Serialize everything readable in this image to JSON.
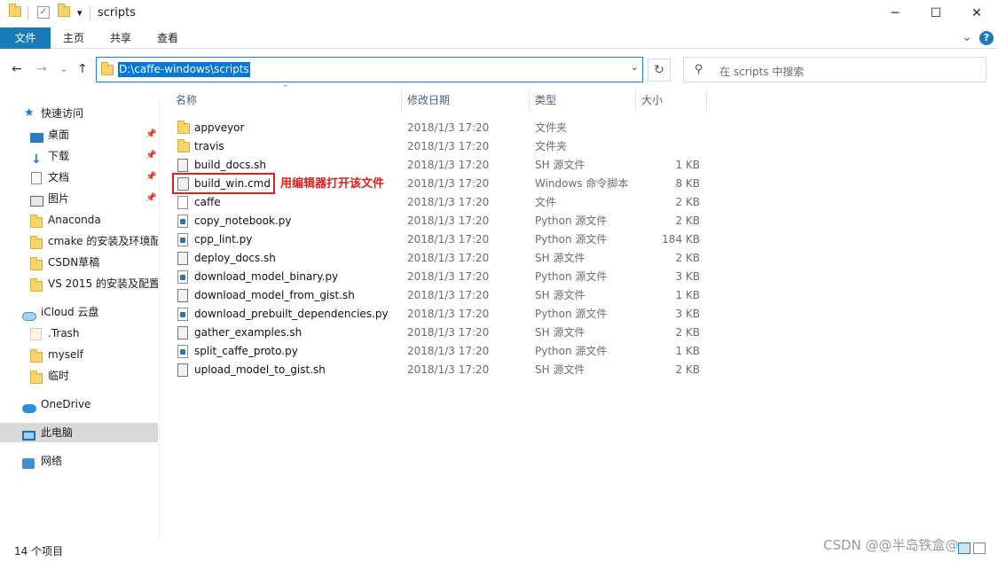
{
  "window": {
    "title": "scripts",
    "minimize": "─",
    "maximize": "☐",
    "close": "✕",
    "quick_access_dropdown": "▾"
  },
  "ribbon": {
    "tabs": [
      "文件",
      "主页",
      "共享",
      "查看"
    ],
    "expand": "⌄",
    "help": "?"
  },
  "address": {
    "path": "D:\\caffe-windows\\scripts",
    "dropdown": "⌄",
    "refresh": "↻",
    "back": "←",
    "forward": "→",
    "recent": "⌄",
    "up": "↑"
  },
  "search": {
    "placeholder": "在 scripts 中搜索"
  },
  "sidebar": {
    "quick_access": "快速访问",
    "items": [
      {
        "label": "桌面",
        "pinned": true
      },
      {
        "label": "下载",
        "pinned": true
      },
      {
        "label": "文档",
        "pinned": true
      },
      {
        "label": "图片",
        "pinned": true
      },
      {
        "label": "Anaconda"
      },
      {
        "label": "cmake 的安装及环境配"
      },
      {
        "label": "CSDN草稿"
      },
      {
        "label": "VS 2015 的安装及配置"
      }
    ],
    "icloud": "iCloud 云盘",
    "icloud_items": [
      ".Trash",
      "myself",
      "临时"
    ],
    "onedrive": "OneDrive",
    "this_pc": "此电脑",
    "network": "网络"
  },
  "columns": {
    "name": "名称",
    "date": "修改日期",
    "type": "类型",
    "size": "大小"
  },
  "files": [
    {
      "name": "appveyor",
      "date": "2018/1/3 17:20",
      "type": "文件夹",
      "size": "",
      "icon": "folder-icon"
    },
    {
      "name": "travis",
      "date": "2018/1/3 17:20",
      "type": "文件夹",
      "size": "",
      "icon": "folder-icon"
    },
    {
      "name": "build_docs.sh",
      "date": "2018/1/3 17:20",
      "type": "SH 源文件",
      "size": "1 KB",
      "icon": "shell-script-icon"
    },
    {
      "name": "build_win.cmd",
      "date": "2018/1/3 17:20",
      "type": "Windows 命令脚本",
      "size": "8 KB",
      "icon": "cmd-script-icon"
    },
    {
      "name": "caffe",
      "date": "2018/1/3 17:20",
      "type": "文件",
      "size": "2 KB",
      "icon": "file-icon"
    },
    {
      "name": "copy_notebook.py",
      "date": "2018/1/3 17:20",
      "type": "Python 源文件",
      "size": "2 KB",
      "icon": "python-file-icon"
    },
    {
      "name": "cpp_lint.py",
      "date": "2018/1/3 17:20",
      "type": "Python 源文件",
      "size": "184 KB",
      "icon": "python-file-icon"
    },
    {
      "name": "deploy_docs.sh",
      "date": "2018/1/3 17:20",
      "type": "SH 源文件",
      "size": "2 KB",
      "icon": "shell-script-icon"
    },
    {
      "name": "download_model_binary.py",
      "date": "2018/1/3 17:20",
      "type": "Python 源文件",
      "size": "3 KB",
      "icon": "python-file-icon"
    },
    {
      "name": "download_model_from_gist.sh",
      "date": "2018/1/3 17:20",
      "type": "SH 源文件",
      "size": "1 KB",
      "icon": "shell-script-icon"
    },
    {
      "name": "download_prebuilt_dependencies.py",
      "date": "2018/1/3 17:20",
      "type": "Python 源文件",
      "size": "3 KB",
      "icon": "python-file-icon"
    },
    {
      "name": "gather_examples.sh",
      "date": "2018/1/3 17:20",
      "type": "SH 源文件",
      "size": "2 KB",
      "icon": "shell-script-icon"
    },
    {
      "name": "split_caffe_proto.py",
      "date": "2018/1/3 17:20",
      "type": "Python 源文件",
      "size": "1 KB",
      "icon": "python-file-icon"
    },
    {
      "name": "upload_model_to_gist.sh",
      "date": "2018/1/3 17:20",
      "type": "SH 源文件",
      "size": "2 KB",
      "icon": "shell-script-icon"
    }
  ],
  "annotation": "用编辑器打开该文件",
  "status": {
    "item_count": "14 个项目"
  },
  "watermark": "CSDN @@半岛铁盒@",
  "colors": {
    "accent": "#1b7bb9",
    "selection": "#0078d7",
    "annotation": "#e02020"
  }
}
